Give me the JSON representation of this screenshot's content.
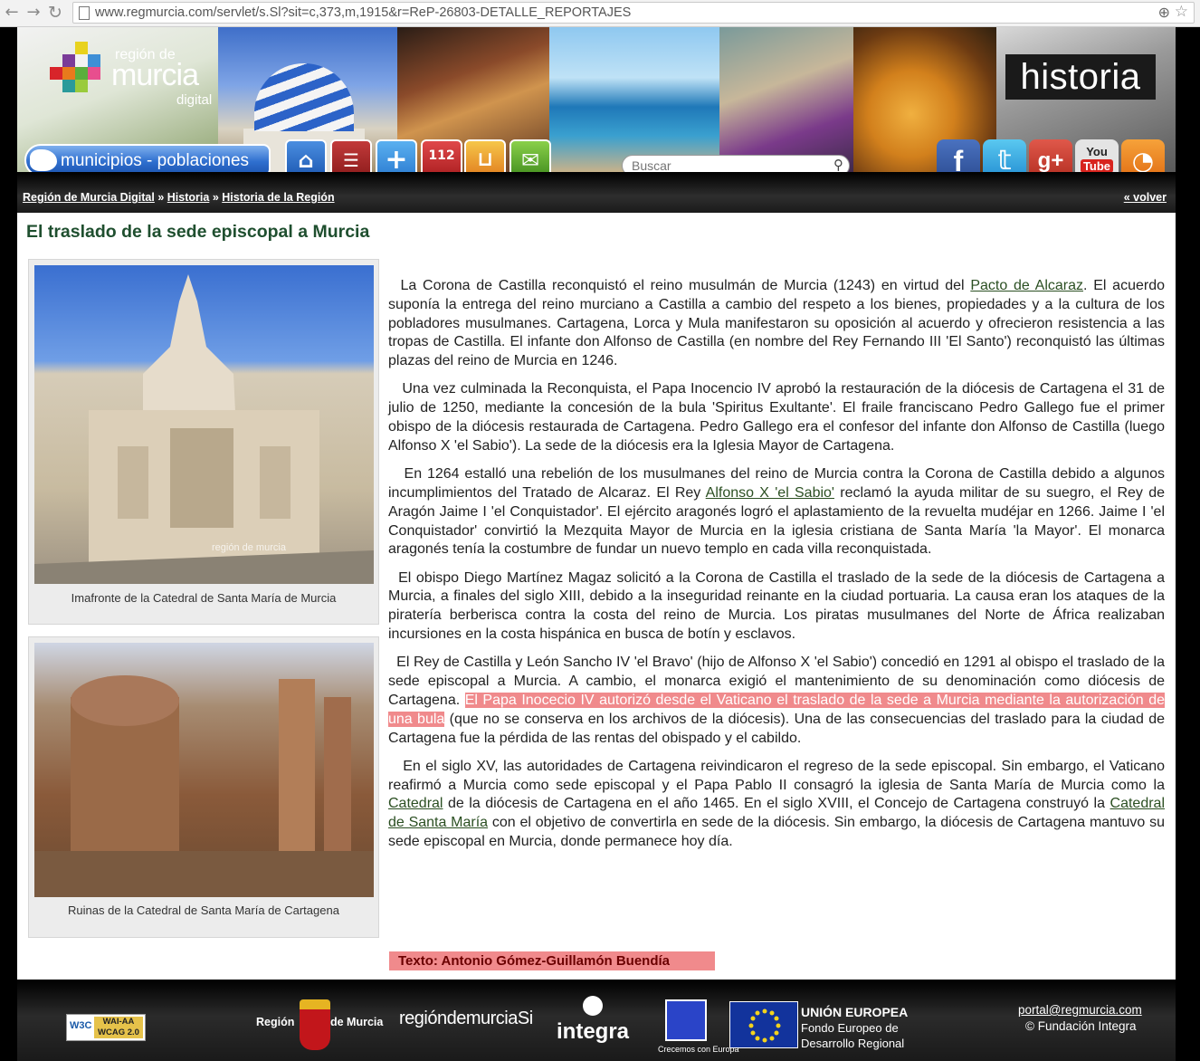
{
  "browser": {
    "url": "www.regmurcia.com/servlet/s.Sl?sit=c,373,m,1915&r=ReP-26803-DETALLE_REPORTAJES"
  },
  "header": {
    "logo_line1": "región de",
    "logo_line2": "murcia",
    "logo_line3": "digital",
    "section_badge": "historia",
    "municipios_label": "municipios - poblaciones",
    "emergency_number": "112",
    "search_placeholder": "Buscar",
    "icons": [
      "home-icon",
      "contacts-icon",
      "health-cross-icon",
      "emergency-112-icon",
      "shopping-basket-icon",
      "mail-icon"
    ],
    "social": [
      "facebook-icon",
      "twitter-icon",
      "google-plus-icon",
      "youtube-icon",
      "rss-icon"
    ]
  },
  "breadcrumb": {
    "items": [
      "Región de Murcia Digital",
      "Historia",
      "Historia de la Región"
    ],
    "separator": "»",
    "back_label": "« volver"
  },
  "article": {
    "title": "El traslado de la sede episcopal a Murcia",
    "figures": [
      {
        "caption": "Imafronte de la Catedral de Santa María de Murcia",
        "watermark": "región de murcia"
      },
      {
        "caption": "Ruinas de la Catedral de Santa María de Cartagena"
      }
    ],
    "p1": {
      "before": "La Corona de Castilla reconquistó el reino musulmán de Murcia (1243) en virtud del ",
      "link": "Pacto de Alcaraz",
      "after": ". El acuerdo suponía la entrega del reino murciano a Castilla a cambio del respeto a los bienes, propiedades y a la cultura de los pobladores musulmanes. Cartagena, Lorca y Mula manifestaron su oposición al acuerdo y ofrecieron resistencia a las tropas de Castilla. El infante don Alfonso de Castilla (en nombre del Rey Fernando III 'El Santo') reconquistó las últimas plazas del reino de Murcia en 1246."
    },
    "p2": "Una vez culminada la Reconquista, el Papa Inocencio IV aprobó la restauración de la diócesis de Cartagena el 31 de julio de 1250, mediante la concesión de la bula 'Spiritus Exultante'. El fraile franciscano Pedro Gallego fue el primer obispo de la diócesis restaurada de Cartagena. Pedro Gallego era el confesor del infante don Alfonso de Castilla (luego Alfonso X 'el Sabio'). La sede de la diócesis era la Iglesia Mayor de Cartagena.",
    "p3": {
      "before": "En 1264 estalló una rebelión de los musulmanes del reino de Murcia contra la Corona de Castilla debido a algunos incumplimientos del Tratado de Alcaraz. El Rey ",
      "link": "Alfonso X 'el Sabio'",
      "after": " reclamó la ayuda militar de su suegro, el Rey de Aragón Jaime I 'el Conquistador'. El ejército aragonés logró el aplastamiento de la revuelta mudéjar en 1266. Jaime I 'el Conquistador' convirtió la Mezquita Mayor de Murcia en la iglesia cristiana de Santa María 'la Mayor'. El monarca aragonés tenía la costumbre de fundar un nuevo templo en cada villa reconquistada."
    },
    "p4": "El obispo Diego Martínez Magaz solicitó a la Corona de Castilla el traslado de la sede de la diócesis de Cartagena a Murcia, a finales del siglo XIII, debido a la inseguridad reinante en la ciudad portuaria. La causa eran los ataques de la piratería berberisca contra la costa del reino de Murcia. Los piratas musulmanes del Norte de África realizaban incursiones en la costa hispánica en busca de botín y esclavos.",
    "p5": {
      "before": "El Rey de Castilla y León Sancho IV 'el Bravo' (hijo de Alfonso X 'el Sabio') concedió en 1291 al obispo el traslado de la sede episcopal a Murcia. A cambio, el monarca exigió el mantenimiento de su denominación como diócesis de Cartagena. ",
      "highlight": "El Papa Inocecio IV autorizó desde el Vaticano el traslado de la sede a Murcia mediante la autorización de una bula",
      "after": " (que no se conserva en los archivos de la diócesis). Una de las consecuencias del traslado para la ciudad de Cartagena fue la pérdida de las rentas del obispado y el cabildo."
    },
    "p6": {
      "part1": "En el siglo XV, las autoridades de Cartagena reivindicaron el regreso de la sede episcopal. Sin embargo, el Vaticano reafirmó a Murcia como sede episcopal y el Papa Pablo II consagró la iglesia de Santa María de Murcia como la ",
      "link1": "Catedral",
      "part2": " de la diócesis de Cartagena en el año 1465. En el siglo XVIII, el Concejo de Cartagena construyó la ",
      "link2": "Catedral de Santa María",
      "part3": " con el objetivo de convertirla en sede de la diócesis. Sin embargo, la diócesis de Cartagena mantuvo su sede episcopal en Murcia, donde permanece hoy día."
    },
    "credit": "Texto: Antonio Gómez-Guillamón Buendía"
  },
  "footer": {
    "w3c_left": "W3C",
    "w3c_line1": "WAI-AA",
    "w3c_line2": "WCAG 2.0",
    "region_left": "Región",
    "region_right": "de Murcia",
    "regiondigital": "regióndemurciaSi",
    "integra": "integra",
    "crecemos": "Crecemos con Europa",
    "eu_title": "UNIÓN EUROPEA",
    "eu_line1": "Fondo Europeo de",
    "eu_line2": "Desarrollo Regional",
    "email": "portal@regmurcia.com",
    "copyright": "© Fundación Integra"
  },
  "colors": {
    "title_green": "#1f4f2f",
    "highlight": "#f08a8c",
    "credit_text": "#6b0000"
  }
}
